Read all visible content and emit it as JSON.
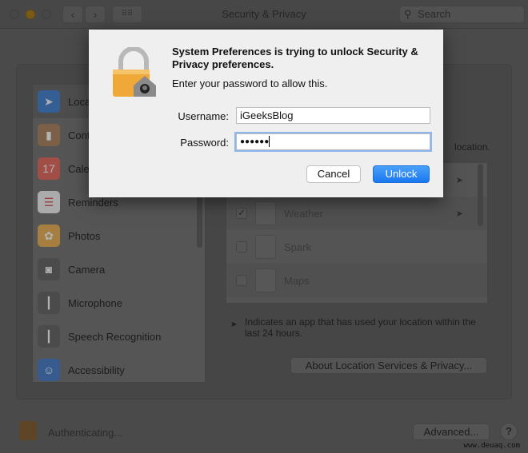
{
  "window": {
    "title": "Security & Privacy",
    "search_placeholder": "Search",
    "icons": {
      "back": "chevron-left-icon",
      "forward": "chevron-right-icon",
      "grid": "grid-icon",
      "search": "search-icon"
    }
  },
  "sidebar": {
    "items": [
      {
        "label": "Loca",
        "icon": "location-arrow-icon",
        "color": "#1f6fd0",
        "selected": true
      },
      {
        "label": "Cont",
        "icon": "contacts-icon",
        "color": "#9a6a3c"
      },
      {
        "label": "Cale",
        "icon": "calendar-icon",
        "color": "#e04a3a"
      },
      {
        "label": "Reminders",
        "icon": "reminders-icon",
        "color": "#f2f2f2"
      },
      {
        "label": "Photos",
        "icon": "photos-icon",
        "color": "#e8a030"
      },
      {
        "label": "Camera",
        "icon": "camera-icon",
        "color": "#444444"
      },
      {
        "label": "Microphone",
        "icon": "microphone-icon",
        "color": "#444444"
      },
      {
        "label": "Speech Recognition",
        "icon": "waveform-icon",
        "color": "#444444"
      },
      {
        "label": "Accessibility",
        "icon": "accessibility-icon",
        "color": "#1f5fc0"
      }
    ]
  },
  "main": {
    "location_text": "location.",
    "apps": [
      {
        "label": "",
        "checked": false,
        "recent": true
      },
      {
        "label": "Weather",
        "checked": true,
        "recent": true
      },
      {
        "label": "Spark",
        "checked": false,
        "recent": false
      },
      {
        "label": "Maps",
        "checked": false,
        "recent": false
      }
    ],
    "note": "Indicates an app that has used your location within the last 24 hours.",
    "about_button": "About Location Services & Privacy..."
  },
  "footer": {
    "status": "Authenticating...",
    "advanced_button": "Advanced...",
    "help": "?"
  },
  "dialog": {
    "title": "System Preferences is trying to unlock Security & Privacy preferences.",
    "subtitle": "Enter your password to allow this.",
    "username_label": "Username:",
    "username_value": "iGeeksBlog",
    "password_label": "Password:",
    "password_value": "●●●●●●",
    "cancel": "Cancel",
    "unlock": "Unlock",
    "accent": "#1a78ef"
  },
  "watermark": "www.deuaq.com"
}
